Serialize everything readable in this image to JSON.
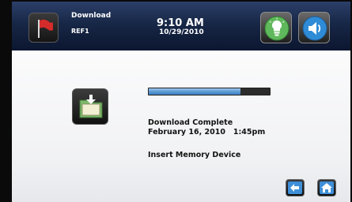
{
  "header": {
    "title": "Download",
    "subtitle": "REF1",
    "time": "9:10 AM",
    "date": "10/29/2010",
    "icons": {
      "flag": "flag-icon",
      "bulb": "lightbulb-icon",
      "speaker": "speaker-icon"
    }
  },
  "main": {
    "folder_icon": "folder-download-icon",
    "progress_fraction": 0.76,
    "status_line": "Download Complete",
    "status_date": "February 16, 2010   1:45pm",
    "instruction": "Insert Memory Device"
  },
  "footer": {
    "back_icon": "back-arrow-icon",
    "home_icon": "home-icon"
  },
  "colors": {
    "header_bg": "#172746",
    "progress_fill": "#5d9bd6",
    "progress_track": "#2c2c2c",
    "bulb_green": "#5fb85b",
    "speaker_blue": "#2f8bd6",
    "nav_blue": "#3f8fd8"
  }
}
